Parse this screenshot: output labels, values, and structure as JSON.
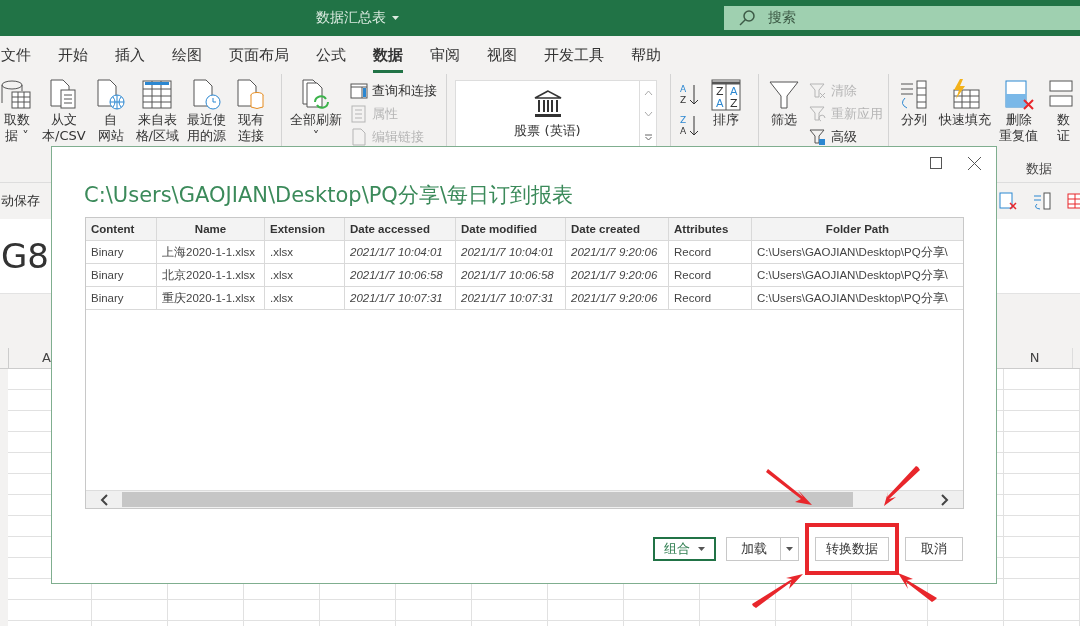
{
  "title_bar": {
    "title": "数据汇总表",
    "search_placeholder": "搜索"
  },
  "menu_tabs": [
    {
      "label": "文件",
      "selected": false
    },
    {
      "label": "开始",
      "selected": false
    },
    {
      "label": "插入",
      "selected": false
    },
    {
      "label": "绘图",
      "selected": false
    },
    {
      "label": "页面布局",
      "selected": false
    },
    {
      "label": "公式",
      "selected": false
    },
    {
      "label": "数据",
      "selected": true
    },
    {
      "label": "审阅",
      "selected": false
    },
    {
      "label": "视图",
      "selected": false
    },
    {
      "label": "开发工具",
      "selected": false
    },
    {
      "label": "帮助",
      "selected": false
    }
  ],
  "ribbon": {
    "groups": [
      {
        "items": [
          {
            "kind": "large",
            "lines": [
              "取数",
              "据 ˅"
            ]
          },
          {
            "kind": "large",
            "lines": [
              "从文",
              "本/CSV"
            ]
          },
          {
            "kind": "large",
            "lines": [
              "自",
              "网站"
            ]
          },
          {
            "kind": "large",
            "lines": [
              "来自表",
              "格/区域"
            ]
          },
          {
            "kind": "large",
            "lines": [
              "最近使",
              "用的源"
            ]
          },
          {
            "kind": "large",
            "lines": [
              "现有",
              "连接"
            ]
          }
        ]
      },
      {
        "items": [
          {
            "kind": "large",
            "lines": [
              "全部刷新",
              "˅"
            ]
          },
          {
            "kind": "stack",
            "entries": [
              {
                "label": "查询和连接",
                "disabled": false
              },
              {
                "label": "属性",
                "disabled": true
              },
              {
                "label": "编辑链接",
                "disabled": true
              }
            ]
          }
        ]
      },
      {
        "items": [
          {
            "kind": "gallery",
            "label": "股票 (英语)"
          }
        ]
      },
      {
        "items": [
          {
            "kind": "sort-pair",
            "pairs": [
              [
                "A",
                "Z"
              ],
              [
                "Z",
                "A"
              ]
            ]
          },
          {
            "kind": "sort-grid",
            "letters": [
              "Z",
              "A",
              "A",
              "Z"
            ],
            "lines": [
              "排序"
            ]
          }
        ]
      },
      {
        "items": [
          {
            "kind": "large",
            "lines": [
              "筛选"
            ]
          },
          {
            "kind": "stack",
            "entries": [
              {
                "label": "清除",
                "disabled": true
              },
              {
                "label": "重新应用",
                "disabled": true
              },
              {
                "label": "高级",
                "disabled": false
              }
            ]
          }
        ]
      },
      {
        "label": "数据",
        "items": [
          {
            "kind": "large",
            "lines": [
              "分列"
            ]
          },
          {
            "kind": "large",
            "lines": [
              "快速填充"
            ]
          },
          {
            "kind": "large",
            "lines": [
              "删除",
              "重复值"
            ]
          },
          {
            "kind": "large",
            "lines": [
              "数",
              "证"
            ]
          }
        ]
      }
    ]
  },
  "quick_bar": {
    "autosave_label": "动保存"
  },
  "name_box": "G8",
  "column_headers": [
    {
      "label": "A"
    },
    {
      "label": "N"
    }
  ],
  "dialog": {
    "title": "C:\\Users\\GAOJIAN\\Desktop\\PQ分享\\每日订到报表",
    "table": {
      "columns": [
        {
          "label": "Content",
          "kind": "text"
        },
        {
          "label": "Name",
          "kind": "text"
        },
        {
          "label": "Extension",
          "kind": "text"
        },
        {
          "label": "Date accessed",
          "kind": "date"
        },
        {
          "label": "Date modified",
          "kind": "date"
        },
        {
          "label": "Date created",
          "kind": "date"
        },
        {
          "label": "Attributes",
          "kind": "text"
        },
        {
          "label": "Folder Path",
          "kind": "text"
        }
      ],
      "rows": [
        [
          "Binary",
          "上海2020-1-1.xlsx",
          ".xlsx",
          "2021/1/7 10:04:01",
          "2021/1/7 10:04:01",
          "2021/1/7 9:20:06",
          "Record",
          "C:\\Users\\GAOJIAN\\Desktop\\PQ分享\\"
        ],
        [
          "Binary",
          "北京2020-1-1.xlsx",
          ".xlsx",
          "2021/1/7 10:06:58",
          "2021/1/7 10:06:58",
          "2021/1/7 9:20:06",
          "Record",
          "C:\\Users\\GAOJIAN\\Desktop\\PQ分享\\"
        ],
        [
          "Binary",
          "重庆2020-1-1.xlsx",
          ".xlsx",
          "2021/1/7 10:07:31",
          "2021/1/7 10:07:31",
          "2021/1/7 9:20:06",
          "Record",
          "C:\\Users\\GAOJIAN\\Desktop\\PQ分享\\"
        ]
      ]
    },
    "buttons": [
      {
        "label": "组合",
        "kind": "dropdown",
        "default": true,
        "highlighted": false
      },
      {
        "label": "加载",
        "kind": "split",
        "default": false,
        "highlighted": false
      },
      {
        "label": "转换数据",
        "kind": "plain",
        "default": false,
        "highlighted": true
      },
      {
        "label": "取消",
        "kind": "plain",
        "default": false,
        "highlighted": false
      }
    ]
  }
}
